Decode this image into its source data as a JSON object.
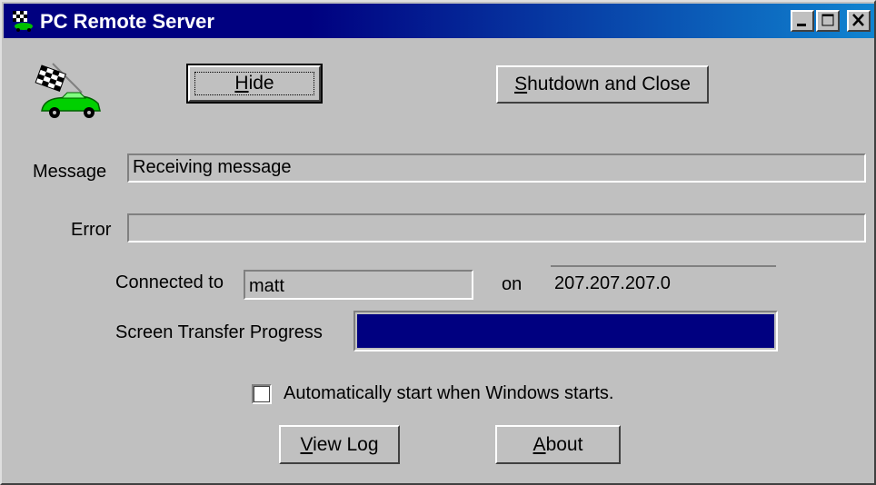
{
  "window": {
    "title": "PC Remote Server",
    "icon": "checkered-flag-car-icon"
  },
  "titlebar_buttons": [
    "minimize-icon",
    "maximize-icon",
    "close-icon"
  ],
  "buttons": {
    "hide": {
      "label_mnemonic": "H",
      "label_rest": "ide"
    },
    "shutdown": {
      "label_mnemonic": "S",
      "label_rest": "hutdown and Close"
    },
    "view_log": {
      "label_mnemonic": "V",
      "label_rest": "iew Log"
    },
    "about": {
      "label_mnemonic": "A",
      "label_rest": "bout"
    }
  },
  "fields": {
    "message_label": "Message",
    "message_value": "Receiving message",
    "error_label": "Error",
    "error_value": "",
    "connected_label": "Connected to",
    "connected_value": "matt",
    "on_label": "on",
    "ip_value": "207.207.207.0",
    "progress_label": "Screen Transfer Progress",
    "progress_fraction": 1.0
  },
  "checkbox": {
    "label": "Automatically start when Windows starts.",
    "checked": false
  },
  "colors": {
    "titlebar_start": "#000080",
    "titlebar_end": "#1084d0",
    "face": "#c0c0c0",
    "progress_fill": "#000080"
  }
}
